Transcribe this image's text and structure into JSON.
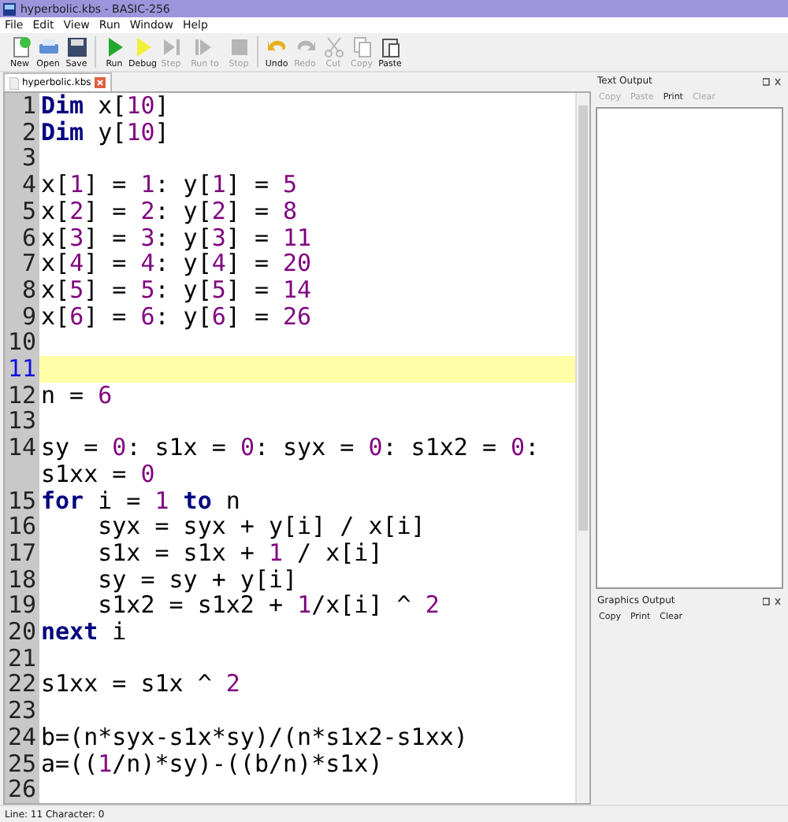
{
  "window": {
    "title": "hyperbolic.kbs - BASIC-256"
  },
  "menu": [
    "File",
    "Edit",
    "View",
    "Run",
    "Window",
    "Help"
  ],
  "toolbar": [
    {
      "kind": "new",
      "label": "New",
      "disabled": false
    },
    {
      "kind": "open",
      "label": "Open",
      "disabled": false
    },
    {
      "kind": "save",
      "label": "Save",
      "disabled": false
    },
    {
      "kind": "run",
      "label": "Run",
      "disabled": false
    },
    {
      "kind": "debug",
      "label": "Debug",
      "disabled": false
    },
    {
      "kind": "step",
      "label": "Step",
      "disabled": true
    },
    {
      "kind": "runto",
      "label": "Run to",
      "disabled": true
    },
    {
      "kind": "stop",
      "label": "Stop",
      "disabled": true
    },
    {
      "kind": "undo",
      "label": "Undo",
      "disabled": false
    },
    {
      "kind": "redo",
      "label": "Redo",
      "disabled": true
    },
    {
      "kind": "cut",
      "label": "Cut",
      "disabled": true
    },
    {
      "kind": "copy",
      "label": "Copy",
      "disabled": true
    },
    {
      "kind": "paste",
      "label": "Paste",
      "disabled": false
    }
  ],
  "tabs": [
    {
      "label": "hyperbolic.kbs",
      "selected": true
    }
  ],
  "editor": {
    "lines": [
      {
        "num": "1",
        "current": false,
        "tokens": [
          {
            "kind": "keyword",
            "text": "Dim"
          },
          {
            "kind": "plain",
            "text": " x["
          },
          {
            "kind": "number",
            "text": "10"
          },
          {
            "kind": "plain",
            "text": "]"
          }
        ]
      },
      {
        "num": "2",
        "current": false,
        "tokens": [
          {
            "kind": "keyword",
            "text": "Dim"
          },
          {
            "kind": "plain",
            "text": " y["
          },
          {
            "kind": "number",
            "text": "10"
          },
          {
            "kind": "plain",
            "text": "]"
          }
        ]
      },
      {
        "num": "3",
        "current": false
      },
      {
        "num": "4",
        "current": false,
        "tokens": [
          {
            "kind": "plain",
            "text": "x["
          },
          {
            "kind": "number",
            "text": "1"
          },
          {
            "kind": "plain",
            "text": "] = "
          },
          {
            "kind": "number",
            "text": "1"
          },
          {
            "kind": "plain",
            "text": ": y["
          },
          {
            "kind": "number",
            "text": "1"
          },
          {
            "kind": "plain",
            "text": "] = "
          },
          {
            "kind": "number",
            "text": "5"
          }
        ]
      },
      {
        "num": "5",
        "current": false,
        "tokens": [
          {
            "kind": "plain",
            "text": "x["
          },
          {
            "kind": "number",
            "text": "2"
          },
          {
            "kind": "plain",
            "text": "] = "
          },
          {
            "kind": "number",
            "text": "2"
          },
          {
            "kind": "plain",
            "text": ": y["
          },
          {
            "kind": "number",
            "text": "2"
          },
          {
            "kind": "plain",
            "text": "] = "
          },
          {
            "kind": "number",
            "text": "8"
          }
        ]
      },
      {
        "num": "6",
        "current": false,
        "tokens": [
          {
            "kind": "plain",
            "text": "x["
          },
          {
            "kind": "number",
            "text": "3"
          },
          {
            "kind": "plain",
            "text": "] = "
          },
          {
            "kind": "number",
            "text": "3"
          },
          {
            "kind": "plain",
            "text": ": y["
          },
          {
            "kind": "number",
            "text": "3"
          },
          {
            "kind": "plain",
            "text": "] = "
          },
          {
            "kind": "number",
            "text": "11"
          }
        ]
      },
      {
        "num": "7",
        "current": false,
        "tokens": [
          {
            "kind": "plain",
            "text": "x["
          },
          {
            "kind": "number",
            "text": "4"
          },
          {
            "kind": "plain",
            "text": "] = "
          },
          {
            "kind": "number",
            "text": "4"
          },
          {
            "kind": "plain",
            "text": ": y["
          },
          {
            "kind": "number",
            "text": "4"
          },
          {
            "kind": "plain",
            "text": "] = "
          },
          {
            "kind": "number",
            "text": "20"
          }
        ]
      },
      {
        "num": "8",
        "current": false,
        "tokens": [
          {
            "kind": "plain",
            "text": "x["
          },
          {
            "kind": "number",
            "text": "5"
          },
          {
            "kind": "plain",
            "text": "] = "
          },
          {
            "kind": "number",
            "text": "5"
          },
          {
            "kind": "plain",
            "text": ": y["
          },
          {
            "kind": "number",
            "text": "5"
          },
          {
            "kind": "plain",
            "text": "] = "
          },
          {
            "kind": "number",
            "text": "14"
          }
        ]
      },
      {
        "num": "9",
        "current": false,
        "tokens": [
          {
            "kind": "plain",
            "text": "x["
          },
          {
            "kind": "number",
            "text": "6"
          },
          {
            "kind": "plain",
            "text": "] = "
          },
          {
            "kind": "number",
            "text": "6"
          },
          {
            "kind": "plain",
            "text": ": y["
          },
          {
            "kind": "number",
            "text": "6"
          },
          {
            "kind": "plain",
            "text": "] = "
          },
          {
            "kind": "number",
            "text": "26"
          }
        ]
      },
      {
        "num": "10",
        "current": false
      },
      {
        "num": "11",
        "current": true
      },
      {
        "num": "12",
        "current": false,
        "tokens": [
          {
            "kind": "plain",
            "text": "n = "
          },
          {
            "kind": "number",
            "text": "6"
          }
        ]
      },
      {
        "num": "13",
        "current": false
      },
      {
        "num": "14",
        "current": false,
        "tokens": [
          {
            "kind": "plain",
            "text": "sy = "
          },
          {
            "kind": "number",
            "text": "0"
          },
          {
            "kind": "plain",
            "text": ": s1x = "
          },
          {
            "kind": "number",
            "text": "0"
          },
          {
            "kind": "plain",
            "text": ": syx = "
          },
          {
            "kind": "number",
            "text": "0"
          },
          {
            "kind": "plain",
            "text": ": s1x2 = "
          },
          {
            "kind": "number",
            "text": "0"
          },
          {
            "kind": "plain",
            "text": ": s1xx = "
          },
          {
            "kind": "number",
            "text": "0"
          }
        ]
      },
      {
        "num": "15",
        "current": false,
        "tokens": [
          {
            "kind": "keyword",
            "text": "for"
          },
          {
            "kind": "plain",
            "text": " i = "
          },
          {
            "kind": "number",
            "text": "1"
          },
          {
            "kind": "keyword",
            "text": " to"
          },
          {
            "kind": "plain",
            "text": " n"
          }
        ]
      },
      {
        "num": "16",
        "current": false,
        "tokens": [
          {
            "kind": "plain",
            "text": "    syx = syx + y[i] / x[i]"
          }
        ]
      },
      {
        "num": "17",
        "current": false,
        "tokens": [
          {
            "kind": "plain",
            "text": "    s1x = s1x + "
          },
          {
            "kind": "number",
            "text": "1"
          },
          {
            "kind": "plain",
            "text": " / x[i]"
          }
        ]
      },
      {
        "num": "18",
        "current": false,
        "tokens": [
          {
            "kind": "plain",
            "text": "    sy = sy + y[i]"
          }
        ]
      },
      {
        "num": "19",
        "current": false,
        "tokens": [
          {
            "kind": "plain",
            "text": "    s1x2 = s1x2 + "
          },
          {
            "kind": "number",
            "text": "1"
          },
          {
            "kind": "plain",
            "text": "/x[i] ^ "
          },
          {
            "kind": "number",
            "text": "2"
          }
        ]
      },
      {
        "num": "20",
        "current": false,
        "tokens": [
          {
            "kind": "keyword",
            "text": "next"
          },
          {
            "kind": "plain",
            "text": " i"
          }
        ]
      },
      {
        "num": "21",
        "current": false
      },
      {
        "num": "22",
        "current": false,
        "tokens": [
          {
            "kind": "plain",
            "text": "s1xx = s1x ^ "
          },
          {
            "kind": "number",
            "text": "2"
          }
        ]
      },
      {
        "num": "23",
        "current": false
      },
      {
        "num": "24",
        "current": false,
        "tokens": [
          {
            "kind": "plain",
            "text": "b=(n*syx-s1x*sy)/(n*s1x2-s1xx)"
          }
        ]
      },
      {
        "num": "25",
        "current": false,
        "tokens": [
          {
            "kind": "plain",
            "text": "a=(("
          },
          {
            "kind": "number",
            "text": "1"
          },
          {
            "kind": "plain",
            "text": "/n)*sy)-((b/n)*s1x)"
          }
        ]
      },
      {
        "num": "26",
        "current": false
      }
    ]
  },
  "text_output": {
    "title": "Text Output",
    "buttons": [
      {
        "label": "Copy",
        "disabled": true
      },
      {
        "label": "Paste",
        "disabled": true
      },
      {
        "label": "Print",
        "disabled": false
      },
      {
        "label": "Clear",
        "disabled": true
      }
    ]
  },
  "graphics_output": {
    "title": "Graphics Output",
    "buttons": [
      {
        "label": "Copy",
        "disabled": false
      },
      {
        "label": "Print",
        "disabled": false
      },
      {
        "label": "Clear",
        "disabled": false
      }
    ]
  },
  "status_bar": "Line: 11 Character: 0"
}
